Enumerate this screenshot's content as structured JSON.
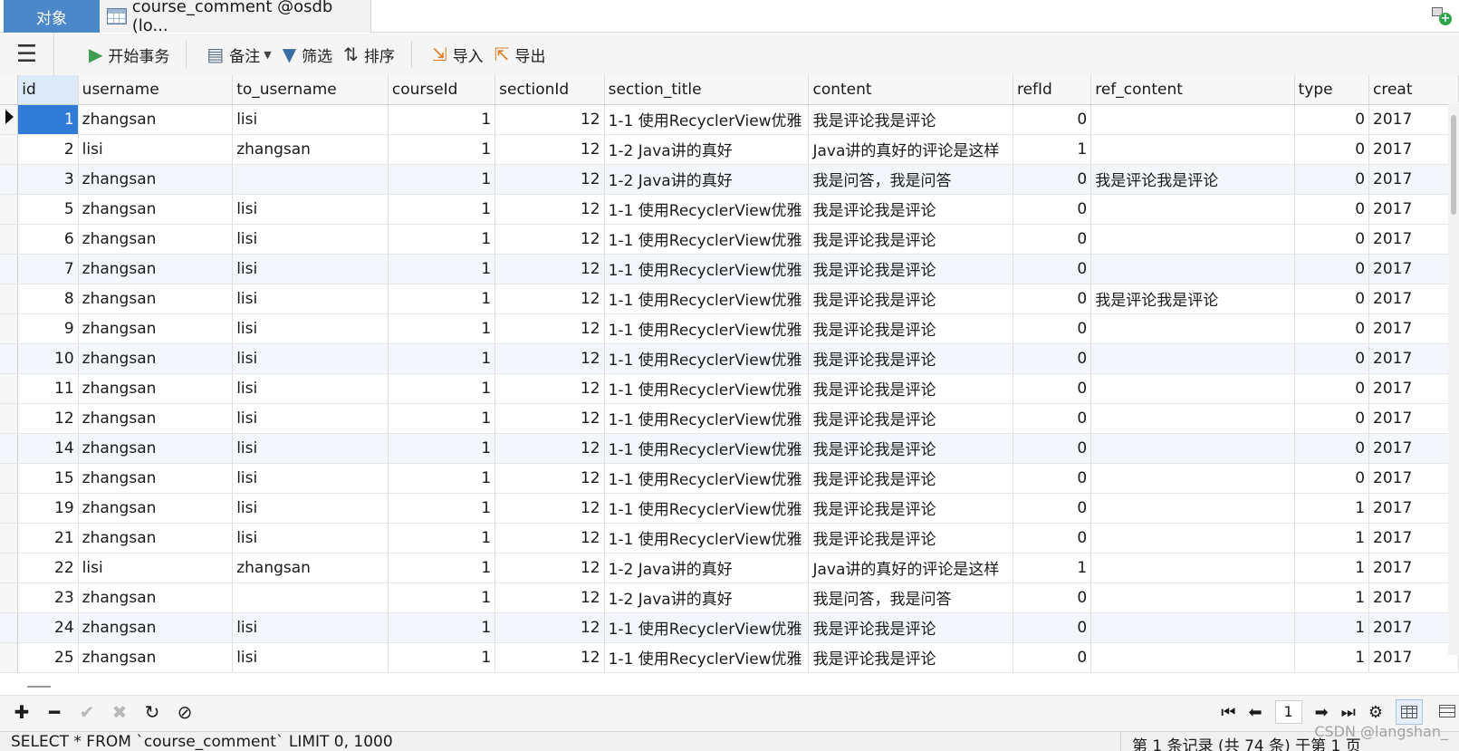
{
  "tabs": {
    "objects_label": "对象",
    "table_tab_label": "course_comment @osdb (lo..."
  },
  "toolbar": {
    "begin_tx": "开始事务",
    "note": "备注",
    "filter": "筛选",
    "sort": "排序",
    "import": "导入",
    "export": "导出"
  },
  "columns": [
    "id",
    "username",
    "to_username",
    "courseId",
    "sectionId",
    "section_title",
    "content",
    "refId",
    "ref_content",
    "type",
    "creat"
  ],
  "rows": [
    [
      "1",
      "zhangsan",
      "lisi",
      "1",
      "12",
      "1-1 使用RecyclerView优雅",
      "我是评论我是评论",
      "0",
      "",
      "0",
      "2017"
    ],
    [
      "2",
      "lisi",
      "zhangsan",
      "1",
      "12",
      "1-2 Java讲的真好",
      "Java讲的真好的评论是这样",
      "1",
      "",
      "0",
      "2017"
    ],
    [
      "3",
      "zhangsan",
      "",
      "1",
      "12",
      "1-2 Java讲的真好",
      "我是问答，我是问答",
      "0",
      "我是评论我是评论",
      "0",
      "2017"
    ],
    [
      "5",
      "zhangsan",
      "lisi",
      "1",
      "12",
      "1-1 使用RecyclerView优雅",
      "我是评论我是评论",
      "0",
      "",
      "0",
      "2017"
    ],
    [
      "6",
      "zhangsan",
      "lisi",
      "1",
      "12",
      "1-1 使用RecyclerView优雅",
      "我是评论我是评论",
      "0",
      "",
      "0",
      "2017"
    ],
    [
      "7",
      "zhangsan",
      "lisi",
      "1",
      "12",
      "1-1 使用RecyclerView优雅",
      "我是评论我是评论",
      "0",
      "",
      "0",
      "2017"
    ],
    [
      "8",
      "zhangsan",
      "lisi",
      "1",
      "12",
      "1-1 使用RecyclerView优雅",
      "我是评论我是评论",
      "0",
      "我是评论我是评论",
      "0",
      "2017"
    ],
    [
      "9",
      "zhangsan",
      "lisi",
      "1",
      "12",
      "1-1 使用RecyclerView优雅",
      "我是评论我是评论",
      "0",
      "",
      "0",
      "2017"
    ],
    [
      "10",
      "zhangsan",
      "lisi",
      "1",
      "12",
      "1-1 使用RecyclerView优雅",
      "我是评论我是评论",
      "0",
      "",
      "0",
      "2017"
    ],
    [
      "11",
      "zhangsan",
      "lisi",
      "1",
      "12",
      "1-1 使用RecyclerView优雅",
      "我是评论我是评论",
      "0",
      "",
      "0",
      "2017"
    ],
    [
      "12",
      "zhangsan",
      "lisi",
      "1",
      "12",
      "1-1 使用RecyclerView优雅",
      "我是评论我是评论",
      "0",
      "",
      "0",
      "2017"
    ],
    [
      "14",
      "zhangsan",
      "lisi",
      "1",
      "12",
      "1-1 使用RecyclerView优雅",
      "我是评论我是评论",
      "0",
      "",
      "0",
      "2017"
    ],
    [
      "15",
      "zhangsan",
      "lisi",
      "1",
      "12",
      "1-1 使用RecyclerView优雅",
      "我是评论我是评论",
      "0",
      "",
      "0",
      "2017"
    ],
    [
      "19",
      "zhangsan",
      "lisi",
      "1",
      "12",
      "1-1 使用RecyclerView优雅",
      "我是评论我是评论",
      "0",
      "",
      "1",
      "2017"
    ],
    [
      "21",
      "zhangsan",
      "lisi",
      "1",
      "12",
      "1-1 使用RecyclerView优雅",
      "我是评论我是评论",
      "0",
      "",
      "1",
      "2017"
    ],
    [
      "22",
      "lisi",
      "zhangsan",
      "1",
      "12",
      "1-2 Java讲的真好",
      "Java讲的真好的评论是这样",
      "1",
      "",
      "1",
      "2017"
    ],
    [
      "23",
      "zhangsan",
      "",
      "1",
      "12",
      "1-2 Java讲的真好",
      "我是问答，我是问答",
      "0",
      "",
      "1",
      "2017"
    ],
    [
      "24",
      "zhangsan",
      "lisi",
      "1",
      "12",
      "1-1 使用RecyclerView优雅",
      "我是评论我是评论",
      "0",
      "",
      "1",
      "2017"
    ],
    [
      "25",
      "zhangsan",
      "lisi",
      "1",
      "12",
      "1-1 使用RecyclerView优雅",
      "我是评论我是评论",
      "0",
      "",
      "1",
      "2017"
    ]
  ],
  "pager": {
    "current_page": "1"
  },
  "status": {
    "sql": "SELECT * FROM `course_comment` LIMIT 0, 1000",
    "record_info": "第 1 条记录 (共 74 条) 于第 1 页"
  },
  "watermark": "CSDN @langshan_",
  "colors": {
    "tab_active": "#4a88c9",
    "selected_cell": "#2f7bd6",
    "alt_row": "#f3f7fc"
  }
}
